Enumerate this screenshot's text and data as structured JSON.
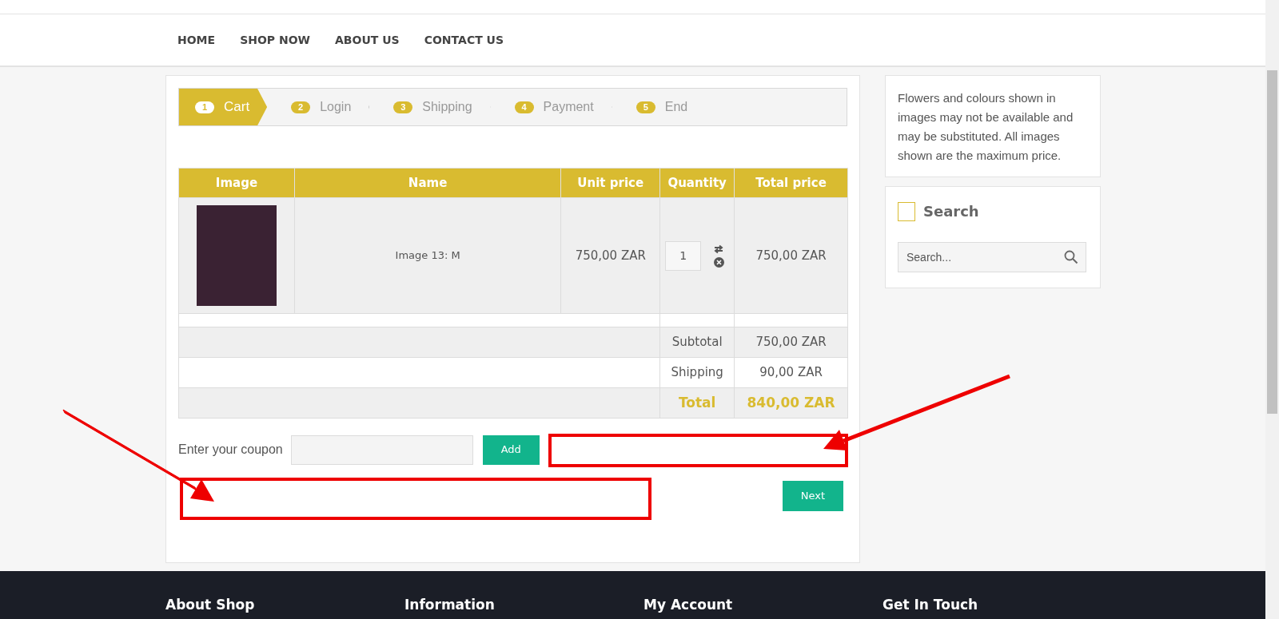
{
  "nav": {
    "items": [
      "HOME",
      "SHOP NOW",
      "ABOUT US",
      "CONTACT US"
    ]
  },
  "steps": [
    {
      "number": "1",
      "label": "Cart",
      "selected": true
    },
    {
      "number": "2",
      "label": "Login",
      "selected": false
    },
    {
      "number": "3",
      "label": "Shipping",
      "selected": false
    },
    {
      "number": "4",
      "label": "Payment",
      "selected": false
    },
    {
      "number": "5",
      "label": "End",
      "selected": false
    }
  ],
  "cart_table": {
    "columns": [
      "Image",
      "Name",
      "Unit price",
      "Quantity",
      "Total price"
    ],
    "rows": [
      {
        "name": "Image 13: M",
        "unit_price": "750,00 ZAR",
        "quantity": "1",
        "total_price": "750,00 ZAR"
      }
    ],
    "totals": [
      {
        "kind": "plain",
        "label": "Subtotal",
        "value": "750,00 ZAR"
      },
      {
        "kind": "plain",
        "label": "Shipping",
        "value": "90,00 ZAR"
      },
      {
        "kind": "grand",
        "label": "Total",
        "value": "840,00 ZAR"
      }
    ]
  },
  "coupon": {
    "label": "Enter your coupon",
    "button": "Add"
  },
  "next_button": "Next",
  "sidebar": {
    "notice": "Flowers and colours shown in images may not be available and may be substituted. All images shown are the maximum price.",
    "search_title": "Search",
    "search_placeholder": "Search..."
  },
  "footer": {
    "headings": [
      "About Shop",
      "Information",
      "My Account",
      "Get In Touch"
    ]
  }
}
